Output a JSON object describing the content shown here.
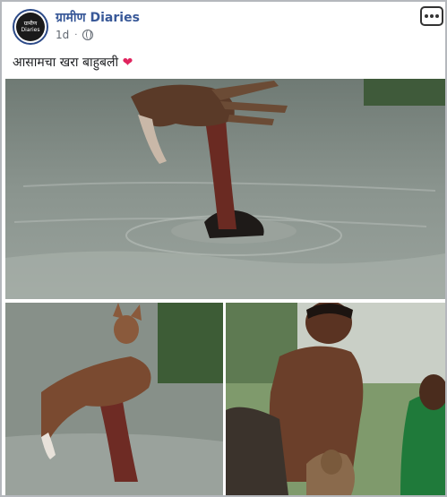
{
  "page": {
    "name": "ग्रामीण Diaries",
    "avatar_text": "ग्रामीण Diaries"
  },
  "post": {
    "time": "1d",
    "text": "आसामचा खरा बाहुबली",
    "heart": "❤"
  },
  "icons": {
    "privacy": "globe-icon",
    "more": "more-options-icon"
  },
  "colors": {
    "page_name": "#385898",
    "heart": "#e0245e",
    "water": "#7d8881"
  }
}
